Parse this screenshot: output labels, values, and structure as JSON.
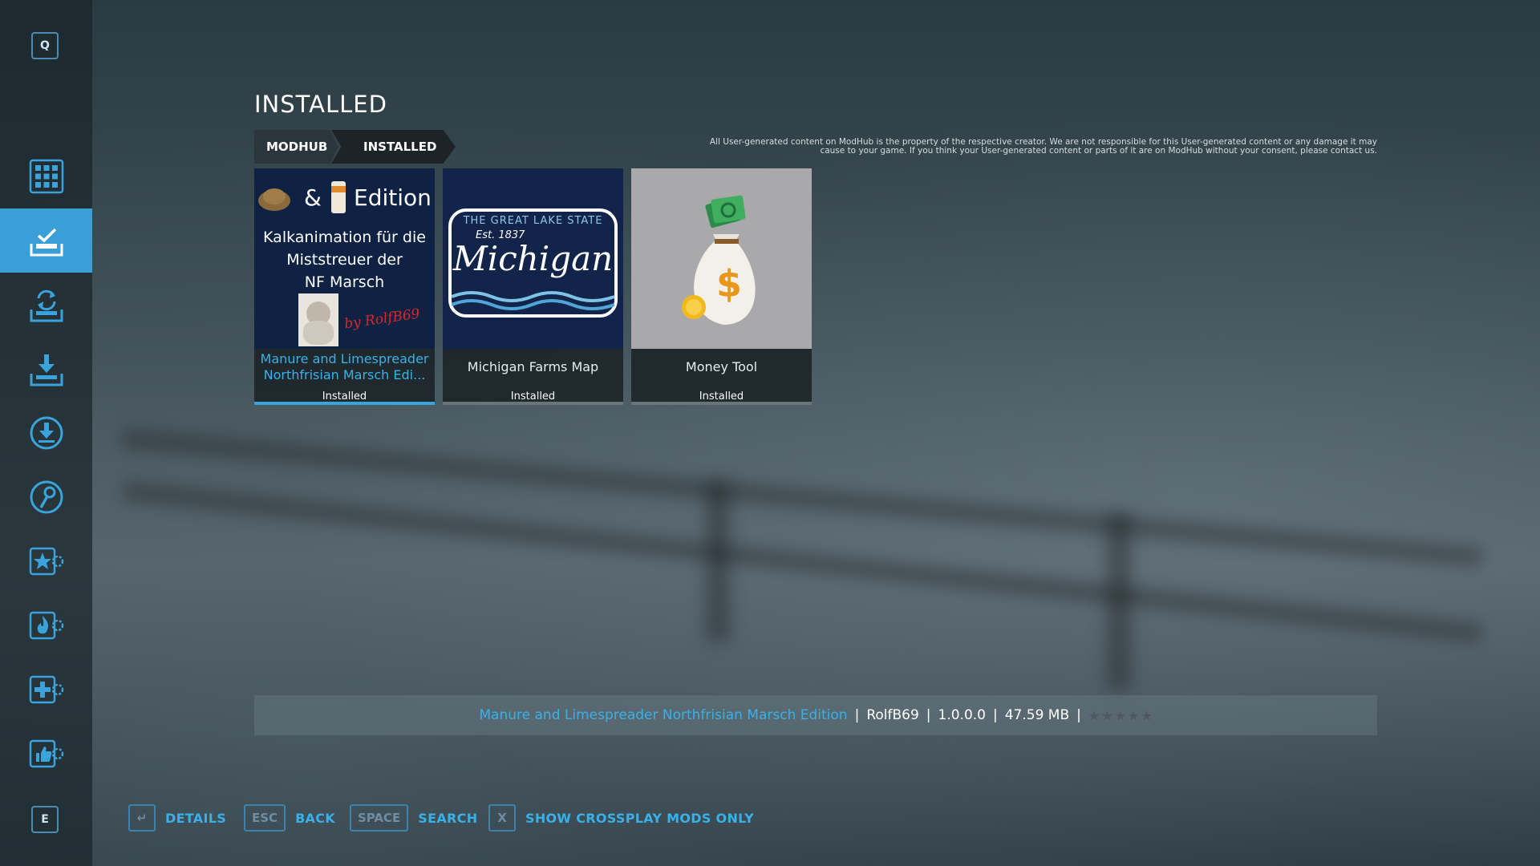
{
  "sidebar": {
    "top_key": "Q",
    "bottom_key": "E",
    "items": [
      {
        "icon": "grid-icon"
      },
      {
        "icon": "installed-tray-icon",
        "active": true
      },
      {
        "icon": "update-sync-icon"
      },
      {
        "icon": "download-tray-icon"
      },
      {
        "icon": "download-circle-icon"
      },
      {
        "icon": "search-key-icon"
      },
      {
        "icon": "star-gear-icon"
      },
      {
        "icon": "fire-gear-icon"
      },
      {
        "icon": "plus-gear-icon"
      },
      {
        "icon": "thumbs-up-gear-icon"
      }
    ]
  },
  "page": {
    "title": "INSTALLED",
    "breadcrumb": [
      "MODHUB",
      "INSTALLED"
    ],
    "disclaimer": "All User-generated content on ModHub is the property of the respective creator. We are not responsible for this User-generated content or any damage it may cause to your game. If you think your User-generated content or parts of it are on ModHub without your consent, please contact us."
  },
  "mods": [
    {
      "title_line1": "Manure and Limespreader",
      "title_line2": "Northfrisian Marsch Edi...",
      "status": "Installed",
      "selected": true,
      "thumb": {
        "edition_text": "Edition",
        "amp": "&",
        "line1": "Kalkanimation für die",
        "line2": "Miststreuer der",
        "line3": "NF Marsch",
        "signature": "by RolfB69"
      }
    },
    {
      "title": "Michigan Farms Map",
      "status": "Installed",
      "thumb": {
        "top_text": "THE GREAT LAKE STATE",
        "est": "Est. 1837",
        "script": "Michigan"
      }
    },
    {
      "title": "Money Tool",
      "status": "Installed",
      "thumb": {
        "symbol": "$"
      }
    }
  ],
  "info": {
    "name": "Manure and Limespreader Northfrisian Marsch Edition",
    "author": "RolfB69",
    "version": "1.0.0.0",
    "size": "47.59 MB",
    "separator": "|",
    "rating_stars": 5,
    "star_glyph": "★"
  },
  "footer": [
    {
      "key": "↵",
      "label": "DETAILS"
    },
    {
      "key": "ESC",
      "label": "BACK"
    },
    {
      "key": "SPACE",
      "label": "SEARCH"
    },
    {
      "key": "X",
      "label": "SHOW CROSSPLAY MODS ONLY"
    }
  ],
  "colors": {
    "accent": "#3ab0e8",
    "active_tab": "#3a9fd6"
  }
}
